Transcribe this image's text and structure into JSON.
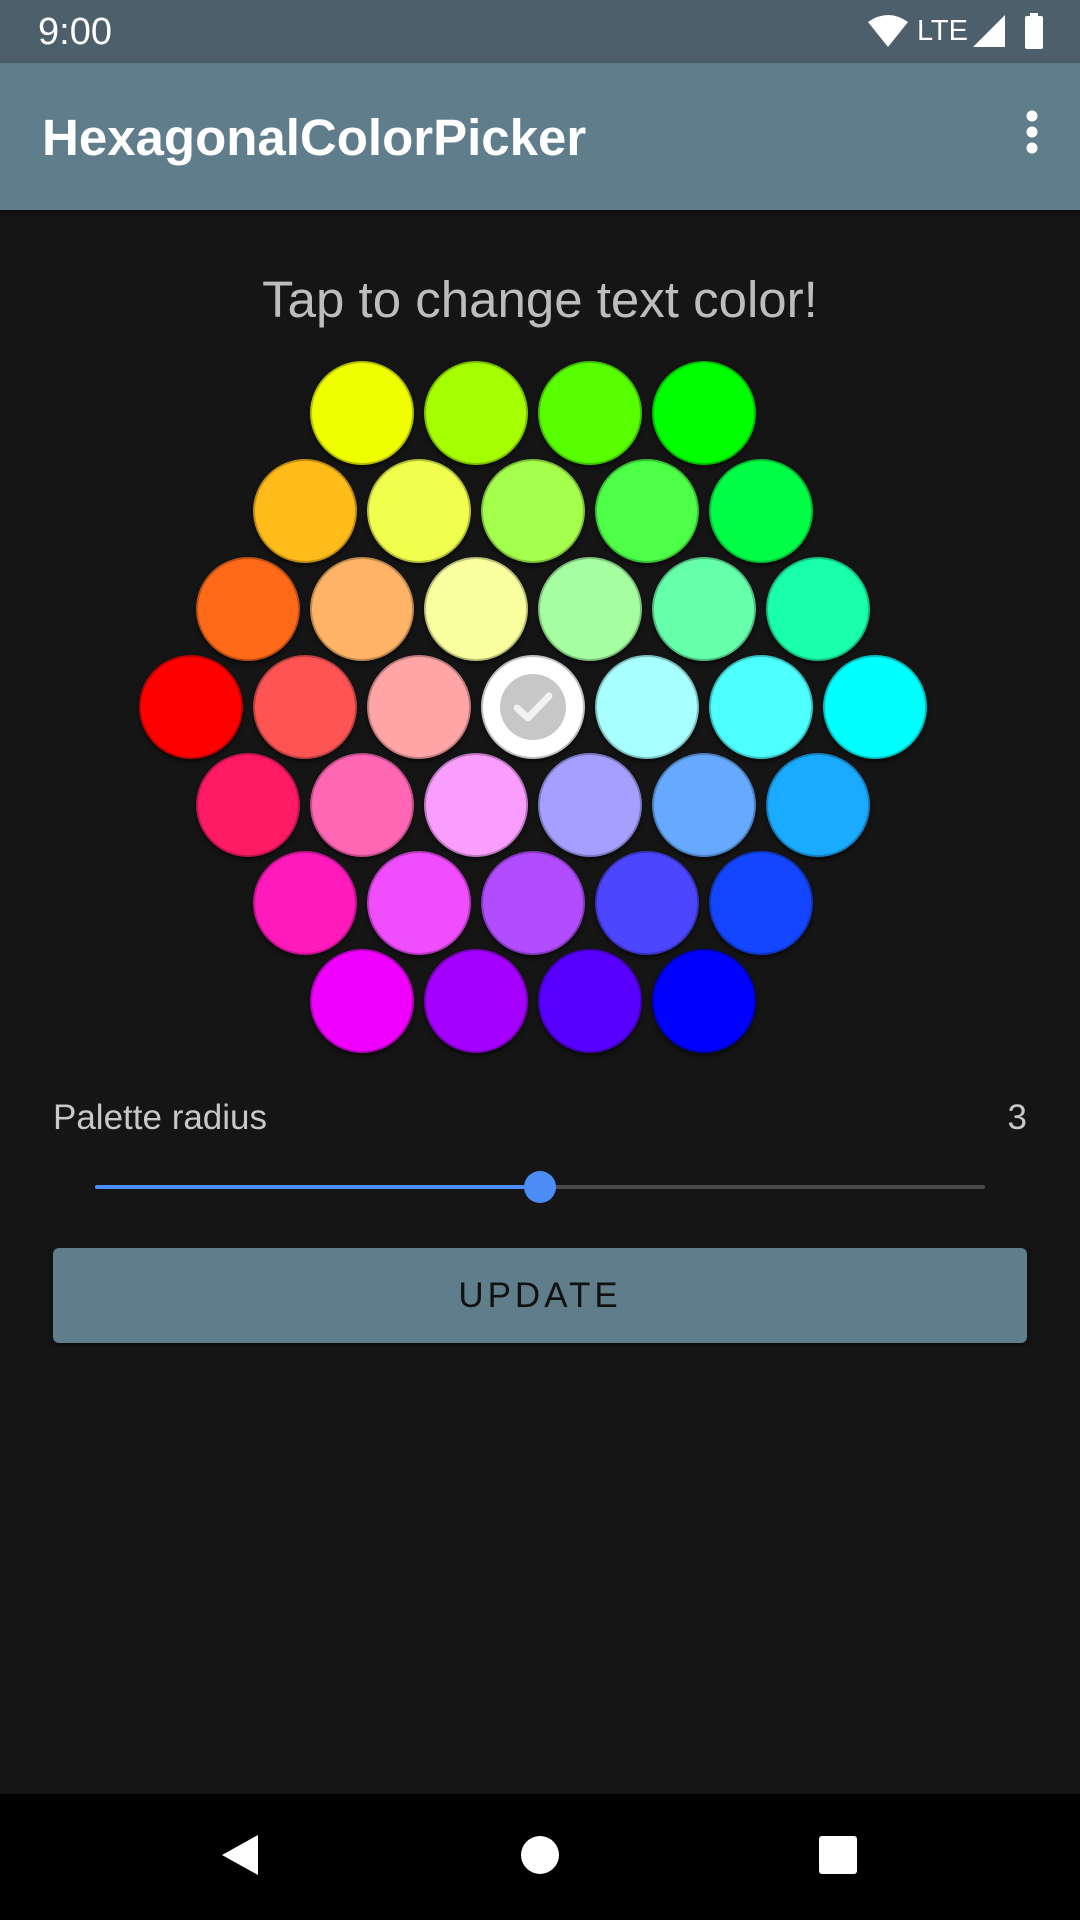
{
  "status_bar": {
    "time": "9:00",
    "network": "LTE",
    "icons": [
      "wifi-icon",
      "cell-signal-icon",
      "battery-icon"
    ]
  },
  "app_bar": {
    "title": "HexagonalColorPicker",
    "menu_icon": "more-vert-icon"
  },
  "prompt": "Tap to change text color!",
  "palette": {
    "selected_color": "#FFFFFF",
    "rows": [
      [
        "#F0FF00",
        "#A5FF00",
        "#58FF00",
        "#00FF00"
      ],
      [
        "#FFBB1A",
        "#F0FF4D",
        "#A5FF4D",
        "#4DFF46",
        "#00FF46"
      ],
      [
        "#FF6A19",
        "#FFB366",
        "#F9FF9E",
        "#A5FFA0",
        "#66FFAA",
        "#19FFAA"
      ],
      [
        "#FF0000",
        "#FF5454",
        "#FFA5A5",
        "#FFFFFF",
        "#A8FFFF",
        "#4DFFFF",
        "#00FFFF"
      ],
      [
        "#FF1A66",
        "#FF66B3",
        "#F99EFF",
        "#A5A0FF",
        "#66AAFF",
        "#1AAAFF"
      ],
      [
        "#FF1ABB",
        "#F04DFF",
        "#B14DFF",
        "#4D46FF",
        "#1446FF"
      ],
      [
        "#F000FF",
        "#A500FF",
        "#5800FF",
        "#0000FF"
      ]
    ]
  },
  "radius_setting": {
    "label": "Palette radius",
    "value": "3",
    "level": 0.5
  },
  "update_button": {
    "label": "UPDATE"
  },
  "nav_bar": {
    "back_icon": "back-triangle-icon",
    "home_icon": "home-circle-icon",
    "recents_icon": "recents-square-icon"
  },
  "colors": {
    "status_bar": "#4C5F6B",
    "app_bar": "#607D8B",
    "background": "#151515",
    "accent": "#4B8CF5"
  }
}
